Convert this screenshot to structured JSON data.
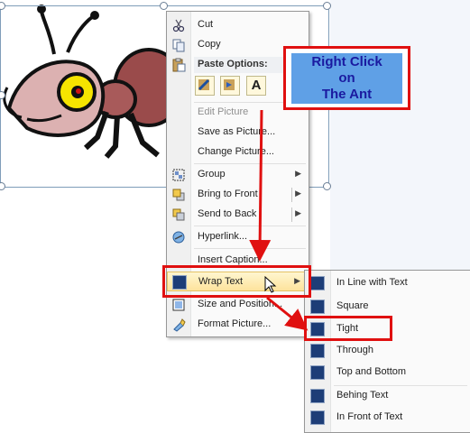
{
  "context_menu": {
    "cut": "Cut",
    "copy": "Copy",
    "paste_options_header": "Paste Options:",
    "paste_text_glyph": "A",
    "edit_picture": "Edit Picture",
    "save_as_picture": "Save as Picture...",
    "change_picture": "Change Picture...",
    "group": "Group",
    "bring_to_front": "Bring to Front",
    "send_to_back": "Send to Back",
    "hyperlink": "Hyperlink...",
    "insert_caption": "Insert Caption...",
    "wrap_text": "Wrap Text",
    "size_and_position": "Size and Position...",
    "format_picture": "Format Picture..."
  },
  "wrap_submenu": {
    "in_line_with_text": "In Line with Text",
    "square": "Square",
    "tight": "Tight",
    "through": "Through",
    "top_and_bottom": "Top and Bottom",
    "behind_text": "Behing Text",
    "in_front_of_text": "In Front of Text"
  },
  "callout": {
    "line1": "Right Click",
    "line2": "on",
    "line3": "The Ant"
  },
  "colors": {
    "annotation_red": "#e01010",
    "callout_fill": "#5fa0e6",
    "callout_text": "#1a1aa0",
    "menu_highlight": "#fde39c"
  },
  "icons": {
    "cut": "scissors-icon",
    "copy": "copy-icon",
    "paste": "paste-icon",
    "group": "group-icon",
    "bring_to_front": "bring-to-front-icon",
    "send_to_back": "send-to-back-icon",
    "hyperlink": "hyperlink-icon",
    "wrap_text": "wrap-text-icon",
    "size_and_position": "size-position-icon",
    "format_picture": "format-picture-icon",
    "submenu_arrow": "chevron-right-icon"
  }
}
